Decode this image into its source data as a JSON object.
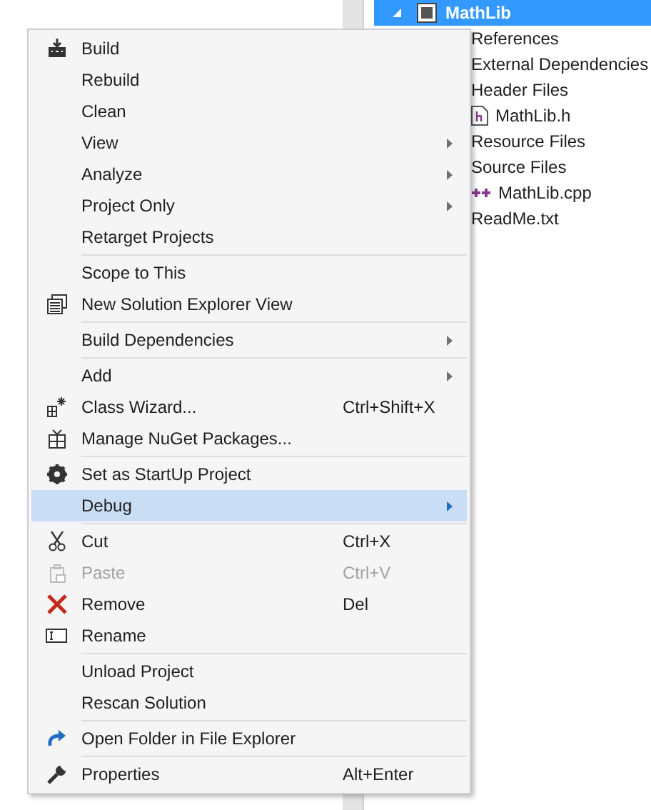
{
  "solution_explorer": {
    "tree": [
      {
        "label": "MathLib",
        "selected": true,
        "expanded": true,
        "children": [
          {
            "label": "References",
            "selected": false
          },
          {
            "label": "External Dependencies",
            "selected": false
          },
          {
            "label": "Header Files",
            "selected": false,
            "children": [
              {
                "label": "MathLib.h",
                "selected": false
              }
            ]
          },
          {
            "label": "Resource Files",
            "selected": false
          },
          {
            "label": "Source Files",
            "selected": false,
            "children": [
              {
                "label": "MathLib.cpp",
                "selected": false
              }
            ]
          },
          {
            "label": "ReadMe.txt",
            "selected": false
          }
        ]
      }
    ]
  },
  "context_menu": {
    "groups": [
      [
        {
          "label": "Build",
          "submenu": false,
          "disabled": false,
          "selected": false
        },
        {
          "label": "Rebuild",
          "submenu": false,
          "disabled": false,
          "selected": false
        },
        {
          "label": "Clean",
          "submenu": false,
          "disabled": false,
          "selected": false
        },
        {
          "label": "View",
          "submenu": true,
          "disabled": false,
          "selected": false
        },
        {
          "label": "Analyze",
          "submenu": true,
          "disabled": false,
          "selected": false
        },
        {
          "label": "Project Only",
          "submenu": true,
          "disabled": false,
          "selected": false
        },
        {
          "label": "Retarget Projects",
          "submenu": false,
          "disabled": false,
          "selected": false
        }
      ],
      [
        {
          "label": "Scope to This",
          "submenu": false,
          "disabled": false,
          "selected": false
        },
        {
          "label": "New Solution Explorer View",
          "submenu": false,
          "disabled": false,
          "selected": false
        }
      ],
      [
        {
          "label": "Build Dependencies",
          "submenu": true,
          "disabled": false,
          "selected": false
        }
      ],
      [
        {
          "label": "Add",
          "submenu": true,
          "disabled": false,
          "selected": false
        },
        {
          "label": "Class Wizard...",
          "shortcut": "Ctrl+Shift+X",
          "submenu": false,
          "disabled": false,
          "selected": false
        },
        {
          "label": "Manage NuGet Packages...",
          "submenu": false,
          "disabled": false,
          "selected": false
        }
      ],
      [
        {
          "label": "Set as StartUp Project",
          "submenu": false,
          "disabled": false,
          "selected": false
        },
        {
          "label": "Debug",
          "submenu": true,
          "disabled": false,
          "selected": true
        }
      ],
      [
        {
          "label": "Cut",
          "shortcut": "Ctrl+X",
          "submenu": false,
          "disabled": false,
          "selected": false
        },
        {
          "label": "Paste",
          "shortcut": "Ctrl+V",
          "submenu": false,
          "disabled": true,
          "selected": false
        },
        {
          "label": "Remove",
          "shortcut": "Del",
          "submenu": false,
          "disabled": false,
          "selected": false
        },
        {
          "label": "Rename",
          "submenu": false,
          "disabled": false,
          "selected": false
        }
      ],
      [
        {
          "label": "Unload Project",
          "submenu": false,
          "disabled": false,
          "selected": false
        },
        {
          "label": "Rescan Solution",
          "submenu": false,
          "disabled": false,
          "selected": false
        }
      ],
      [
        {
          "label": "Open Folder in File Explorer",
          "submenu": false,
          "disabled": false,
          "selected": false
        }
      ],
      [
        {
          "label": "Properties",
          "shortcut": "Alt+Enter",
          "submenu": false,
          "disabled": false,
          "selected": false
        }
      ]
    ]
  }
}
